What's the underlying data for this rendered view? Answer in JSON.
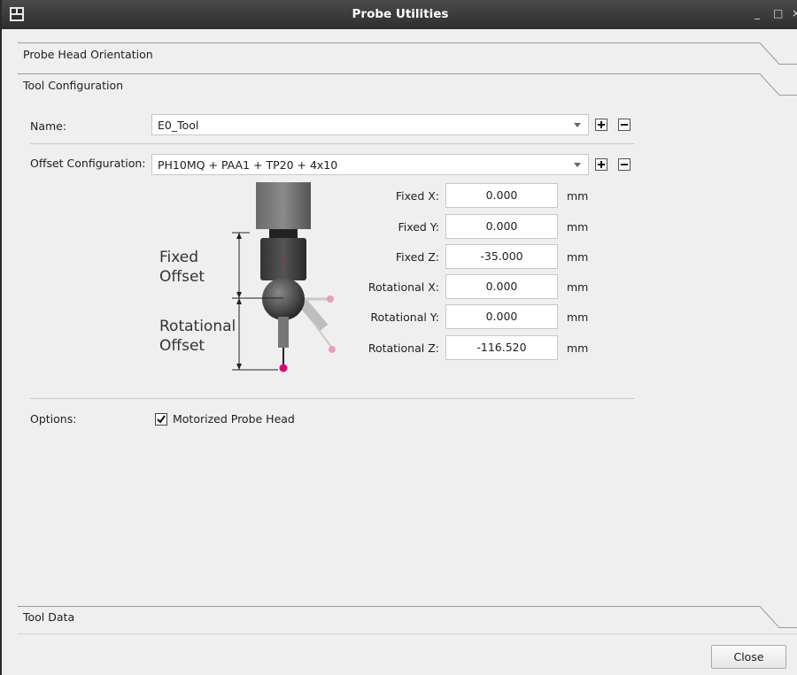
{
  "window": {
    "title": "Probe Utilities",
    "controls": {
      "minimize": "_",
      "maximize": "□",
      "close": "×"
    }
  },
  "sections": {
    "probe_head_orientation": "Probe Head Orientation",
    "tool_configuration": "Tool Configuration",
    "tool_data": "Tool Data"
  },
  "tool": {
    "name_label": "Name:",
    "name_value": "E0_Tool",
    "offset_label": "Offset Configuration:",
    "offset_value": "PH10MQ + PAA1 + TP20 + 4x10"
  },
  "diagram": {
    "fixed_line1": "Fixed",
    "fixed_line2": "Offset",
    "rot_line1": "Rotational",
    "rot_line2": "Offset"
  },
  "offsets": [
    {
      "label": "Fixed X:",
      "value": "0.000",
      "unit": "mm"
    },
    {
      "label": "Fixed Y:",
      "value": "0.000",
      "unit": "mm"
    },
    {
      "label": "Fixed Z:",
      "value": "-35.000",
      "unit": "mm"
    },
    {
      "label": "Rotational X:",
      "value": "0.000",
      "unit": "mm"
    },
    {
      "label": "Rotational Y:",
      "value": "0.000",
      "unit": "mm"
    },
    {
      "label": "Rotational Z:",
      "value": "-116.520",
      "unit": "mm"
    }
  ],
  "options": {
    "label": "Options:",
    "motorized_label": "Motorized Probe Head",
    "motorized_checked": true
  },
  "footer": {
    "close_label": "Close"
  },
  "icons": {
    "app": "app-icon",
    "add": "plus-icon",
    "remove": "minus-icon",
    "dropdown": "chevron-down-icon",
    "check": "check-icon"
  },
  "colors": {
    "titlebar": "#3a3a3a",
    "probe_tip": "#e8006f",
    "probe_tip_ghost": "#f0a0c0"
  }
}
